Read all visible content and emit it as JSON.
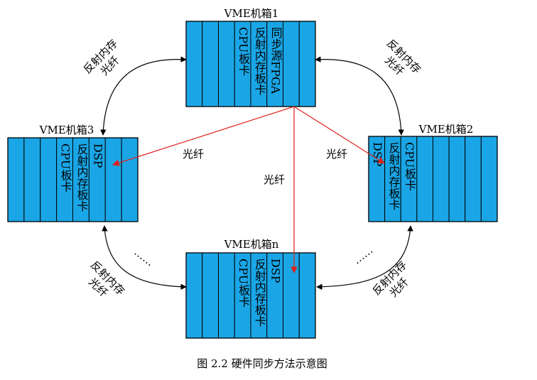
{
  "colors": {
    "slot_fill": "#1aa6e6",
    "outline": "#000000",
    "sync_link": "#e0201a",
    "ring_link": "#000000"
  },
  "chassis": {
    "c1": {
      "title": "VME机箱1",
      "cards": [
        "CPU板卡",
        "反射内存板卡",
        "同步源FPGA"
      ]
    },
    "c2": {
      "title": "VME机箱2",
      "cards": [
        "DSP",
        "反射内存板卡",
        "CPU板卡"
      ]
    },
    "c3": {
      "title": "VME机箱3",
      "cards": [
        "CPU板卡",
        "反射内存板卡",
        "DSP"
      ]
    },
    "cn": {
      "title": "VME机箱n",
      "cards": [
        "CPU板卡",
        "反射内存板卡",
        "DSP"
      ]
    }
  },
  "ring_links": {
    "top_left": "反射内存\n光纤",
    "top_right": "反射内存\n光纤",
    "bottom_left": "反射内存\n光纤",
    "bottom_right": "反射内存\n光纤"
  },
  "sync_links": {
    "to_c3": "光纤",
    "to_c2": "光纤",
    "to_cn": "光纤"
  },
  "ellipsis": "……",
  "caption": "图 2.2  硬件同步方法示意图"
}
